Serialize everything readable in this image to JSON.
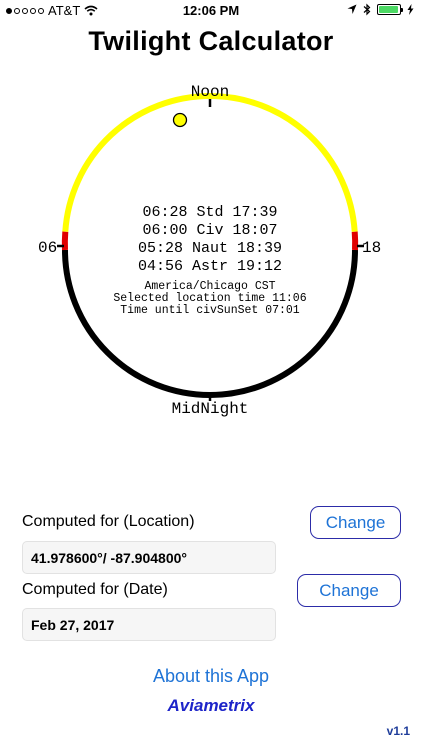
{
  "status_bar": {
    "carrier": "AT&T",
    "time": "12:06 PM",
    "signal_strength": 1,
    "signal_total": 5,
    "battery_percent": 95,
    "battery_color": "#4cd964"
  },
  "title": "Twilight Calculator",
  "dial": {
    "top_label": "Noon",
    "bottom_label": "MidNight",
    "left_label": "06",
    "right_label": "18",
    "daylight_color": "#ffff00",
    "night_color": "#000000",
    "twilight_color": "#e00000",
    "sun_color": "#ffff00",
    "lines": [
      "06:28 Std 17:39",
      "06:00 Civ 18:07",
      "05:28 Naut 18:39",
      "04:56 Astr 19:12"
    ],
    "timezone": "America/Chicago CST",
    "selected_time": "Selected location time 11:06",
    "time_until": "Time until civSunSet 07:01"
  },
  "location": {
    "label": "Computed for (Location)",
    "value": "41.978600°/ -87.904800°",
    "button": "Change"
  },
  "date": {
    "label": "Computed for (Date)",
    "value": "Feb 27, 2017",
    "button": "Change"
  },
  "about_link": "About this App",
  "brand": "Aviametrix",
  "version": "v1.1"
}
